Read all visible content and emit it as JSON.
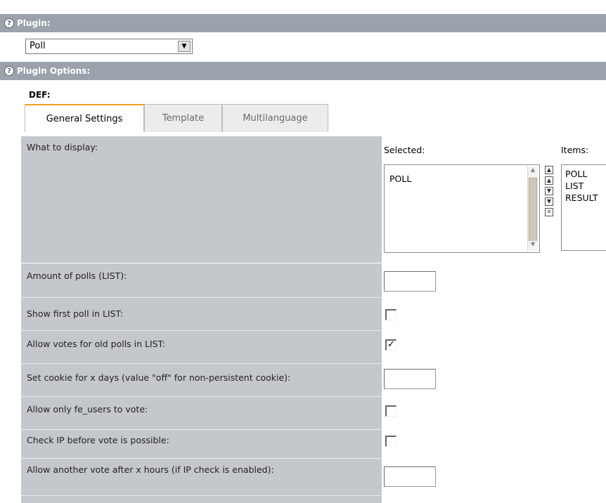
{
  "plugin_section": {
    "title": "Plugin:",
    "help_glyph": "?"
  },
  "plugin_select": {
    "value": "Poll"
  },
  "options_section": {
    "title": "Plugin Options:",
    "help_glyph": "?"
  },
  "sheet_label": "DEF:",
  "tabs": [
    {
      "label": "General Settings",
      "active": true
    },
    {
      "label": "Template",
      "active": false
    },
    {
      "label": "Multilanguage",
      "active": false
    }
  ],
  "display": {
    "label": "What to display:",
    "selected_header": "Selected:",
    "items_header": "Items:",
    "selected_items": [
      "POLL"
    ],
    "available_items": [
      "POLL",
      "LIST",
      "RESULT"
    ]
  },
  "fields": [
    {
      "label": "Amount of polls (LIST):",
      "type": "text",
      "value": ""
    },
    {
      "label": "Show first poll in LIST:",
      "type": "checkbox",
      "checked": false
    },
    {
      "label": "Allow votes for old polls in LIST:",
      "type": "checkbox",
      "checked": true
    },
    {
      "label": "Set cookie for x days (value \"off\" for non-persistent cookie):",
      "type": "text",
      "value": ""
    },
    {
      "label": "Allow only fe_users to vote:",
      "type": "checkbox",
      "checked": false
    },
    {
      "label": "Check IP before vote is possible:",
      "type": "checkbox",
      "checked": false
    },
    {
      "label": "Allow another vote after x hours (if IP check is enabled):",
      "type": "text",
      "value": ""
    }
  ],
  "colors": {
    "section_bar": "#9ba2ab",
    "label_cell": "#c4c8cc",
    "active_tab_accent": "#f0a020"
  }
}
